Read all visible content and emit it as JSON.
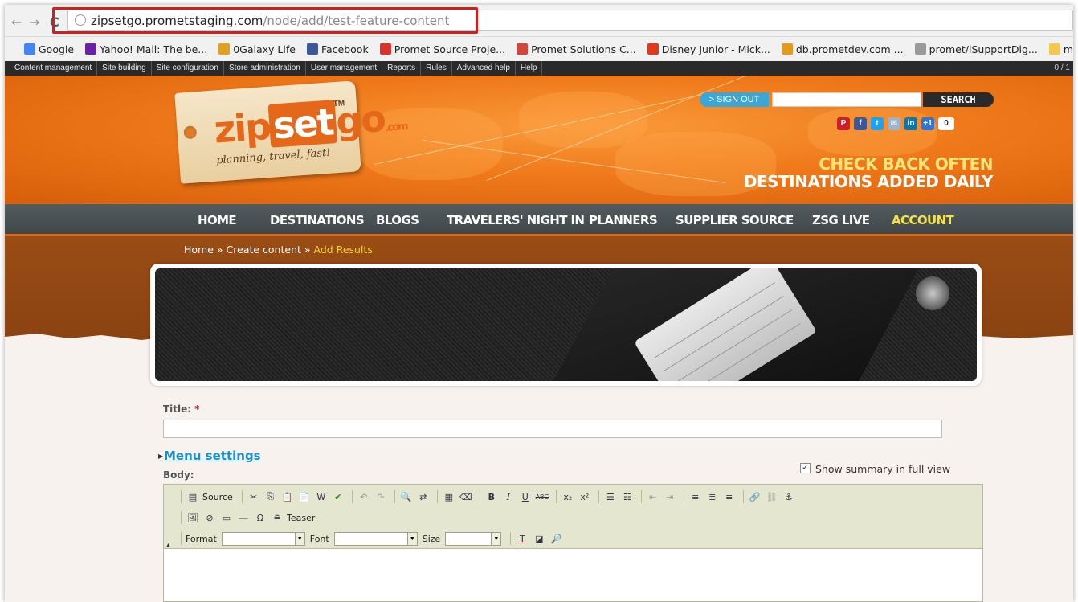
{
  "browser": {
    "url_host": "zipsetgo.prometstaging.com",
    "url_path": "/node/add/test-feature-content",
    "bookmarks": [
      {
        "label": "Google",
        "color": "#4285f4"
      },
      {
        "label": "Yahoo! Mail: The be...",
        "color": "#6b1fa8"
      },
      {
        "label": "0Galaxy Life",
        "color": "#e0a020"
      },
      {
        "label": "Facebook",
        "color": "#3b5998"
      },
      {
        "label": "Promet Source Proje...",
        "color": "#d9342b"
      },
      {
        "label": "Promet Solutions C...",
        "color": "#d44638"
      },
      {
        "label": "Disney Junior - Mick...",
        "color": "#e03a1e"
      },
      {
        "label": "db.prometdev.com ...",
        "color": "#e59a1c"
      },
      {
        "label": "promet/iSupportDig...",
        "color": "#9a9a9a"
      },
      {
        "label": "matt",
        "color": "#f2c94c"
      }
    ]
  },
  "admin_bar": {
    "items": [
      "Content management",
      "Site building",
      "Site configuration",
      "Store administration",
      "User management",
      "Reports",
      "Rules",
      "Advanced help",
      "Help"
    ],
    "right": "0 / 1"
  },
  "header": {
    "logo": {
      "zip": "zip",
      "set": "set",
      "go": "go",
      "com": ".com",
      "tm": "TM",
      "tagline": "planning, travel, fast!"
    },
    "signout": "> SIGN OUT",
    "search_button": "SEARCH",
    "search_placeholder": "",
    "social": [
      {
        "name": "pinterest-icon",
        "glyph": "P",
        "color": "#cb2027"
      },
      {
        "name": "facebook-icon",
        "glyph": "f",
        "color": "#3b5998"
      },
      {
        "name": "twitter-icon",
        "glyph": "t",
        "color": "#1da1f2"
      },
      {
        "name": "email-icon",
        "glyph": "✉",
        "color": "#a0b4c8"
      },
      {
        "name": "linkedin-icon",
        "glyph": "in",
        "color": "#0e76a8"
      },
      {
        "name": "google-plus-icon",
        "glyph": "+1",
        "color": "#2b76d6"
      }
    ],
    "gplus_count": "0",
    "tagline_top": "CHECK BACK OFTEN",
    "tagline_bottom": "DESTINATIONS ADDED DAILY"
  },
  "nav": {
    "items": [
      "HOME",
      "DESTINATIONS",
      "BLOGS",
      "TRAVELERS' NIGHT IN",
      "PLANNERS",
      "SUPPLIER SOURCE",
      "ZSG LIVE",
      "ACCOUNT"
    ],
    "active": "ACCOUNT"
  },
  "breadcrumb": {
    "home": "Home",
    "sep": " » ",
    "create": "Create content",
    "current": "Add Results"
  },
  "form": {
    "title_label": "Title:",
    "required_mark": "*",
    "title_value": "",
    "menu_settings": "Menu settings",
    "body_label": "Body:",
    "show_summary": "Show summary in full view",
    "show_summary_checked": true
  },
  "editor": {
    "source_label": "Source",
    "teaser_label": "Teaser",
    "format_label": "Format",
    "font_label": "Font",
    "size_label": "Size",
    "format_value": "",
    "font_value": "",
    "size_value": ""
  }
}
